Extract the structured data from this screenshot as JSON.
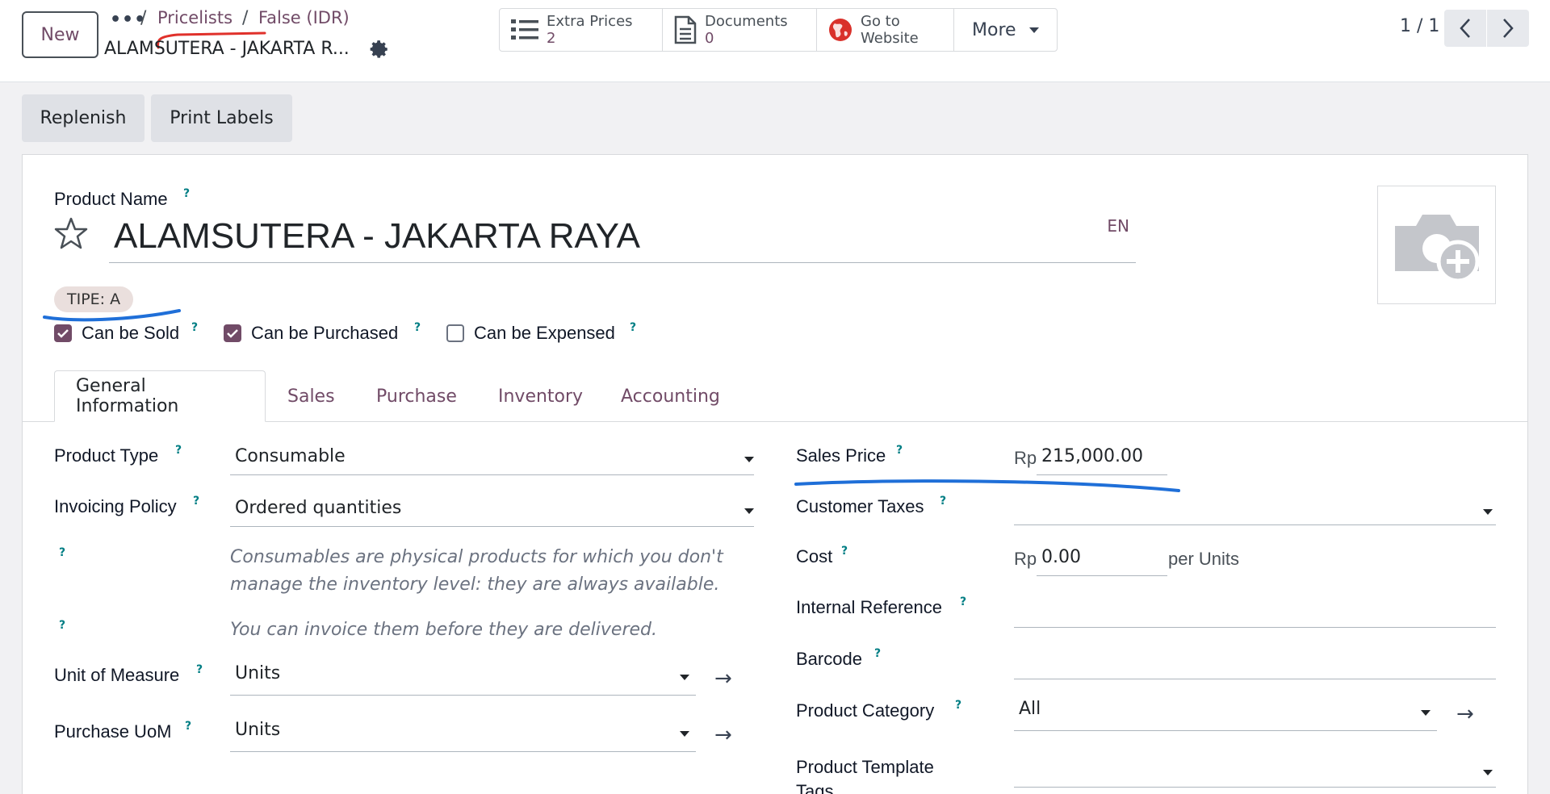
{
  "header": {
    "new_button": "New",
    "breadcrumb": {
      "more": "•••",
      "sep": "/",
      "pricelists": "Pricelists",
      "pricelist": "False (IDR)",
      "current": "ALAMSUTERA - JAKARTA R..."
    },
    "stats": [
      {
        "label": "Extra Prices",
        "value": "2",
        "icon": "list-icon"
      },
      {
        "label": "Documents",
        "value": "0",
        "icon": "document-icon"
      },
      {
        "label": "Go to",
        "value": "Website",
        "icon": "globe-icon"
      }
    ],
    "more_label": "More",
    "pager": "1 / 1"
  },
  "actions": {
    "replenish": "Replenish",
    "print_labels": "Print Labels"
  },
  "product": {
    "name_label": "Product Name",
    "help_mark": "?",
    "name": "ALAMSUTERA - JAKARTA RAYA",
    "lang": "EN",
    "tag": "TIPE: A",
    "can_be_sold": "Can be Sold",
    "can_be_purchased": "Can be Purchased",
    "can_be_expensed": "Can be Expensed"
  },
  "tabs": [
    "General Information",
    "Sales",
    "Purchase",
    "Inventory",
    "Accounting"
  ],
  "general": {
    "product_type_label": "Product Type",
    "product_type": "Consumable",
    "invoicing_policy_label": "Invoicing Policy",
    "invoicing_policy": "Ordered quantities",
    "help_1": "Consumables are physical products for which you don't",
    "help_1b": "manage the inventory level: they are always available.",
    "help_2": "You can invoice them before they are delivered.",
    "uom_label": "Unit of Measure",
    "uom": "Units",
    "purchase_uom_label": "Purchase UoM",
    "purchase_uom": "Units",
    "sales_price_label": "Sales Price",
    "currency": "Rp",
    "sales_price": "215,000.00",
    "customer_taxes_label": "Customer Taxes",
    "cost_label": "Cost",
    "cost": "0.00",
    "cost_unit": "per Units",
    "internal_ref_label": "Internal Reference",
    "barcode_label": "Barcode",
    "category_label": "Product Category",
    "category": "All",
    "template_tags_label_1": "Product Template",
    "template_tags_label_2": "Tags"
  },
  "colors": {
    "accent": "#714b67",
    "help": "#017e84",
    "annotation_blue": "#1f6fd8",
    "annotation_red": "#e0312b"
  }
}
